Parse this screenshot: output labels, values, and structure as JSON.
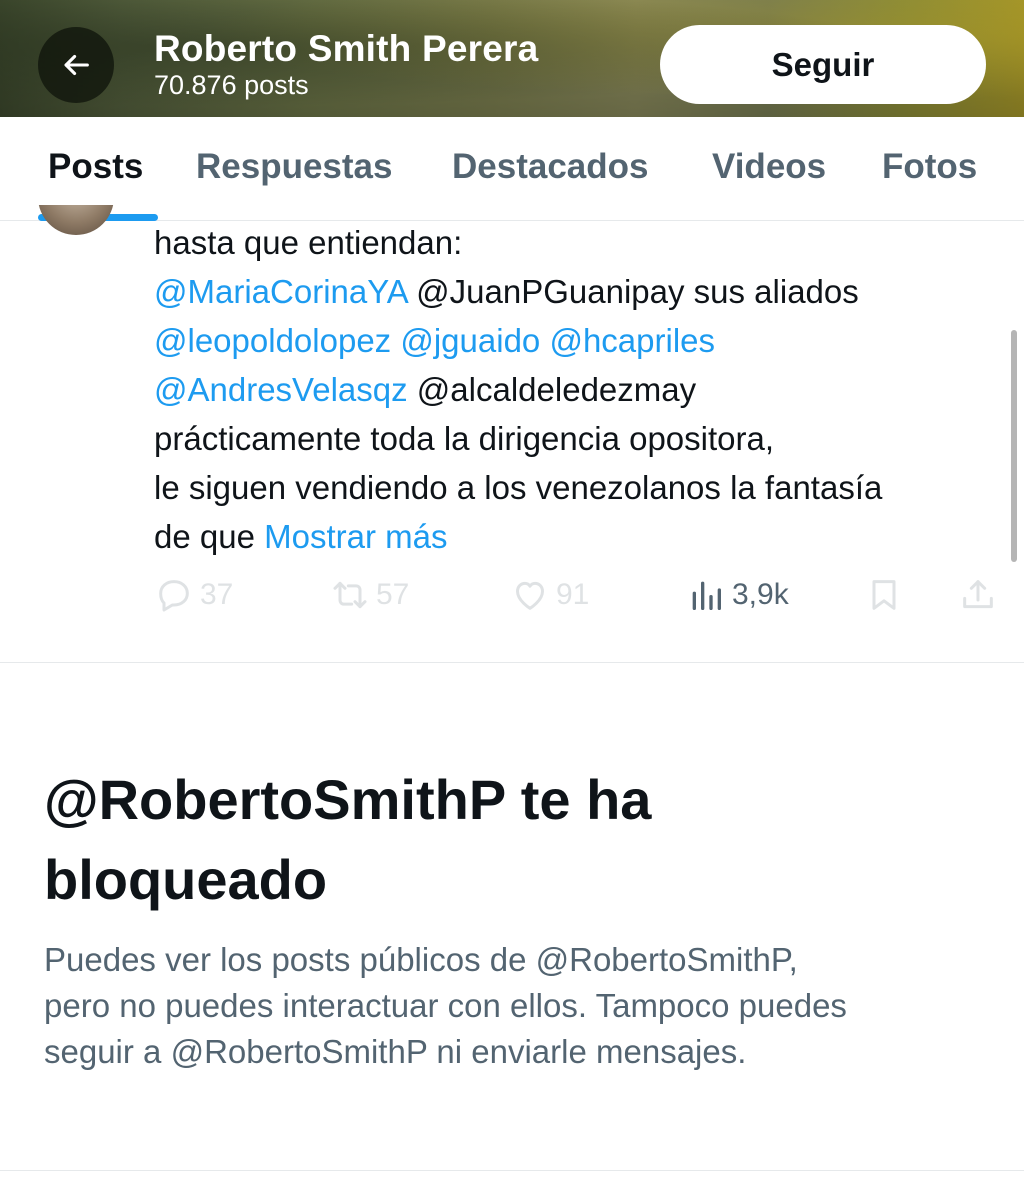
{
  "header": {
    "name": "Roberto Smith Perera",
    "post_count": "70.876 posts",
    "follow_label": "Seguir",
    "back_icon": "arrow-left-icon"
  },
  "tabs": [
    {
      "label": "Posts",
      "active": true
    },
    {
      "label": "Respuestas",
      "active": false
    },
    {
      "label": "Destacados",
      "active": false
    },
    {
      "label": "Videos",
      "active": false
    },
    {
      "label": "Fotos",
      "active": false
    }
  ],
  "tweet": {
    "lines": [
      [
        {
          "t": "hasta que entiendan:",
          "m": false
        }
      ],
      [
        {
          "t": "@MariaCorinaYA",
          "m": true
        },
        {
          "t": " @JuanPGuanipay sus aliados",
          "m": false
        }
      ],
      [
        {
          "t": "@leopoldolopez",
          "m": true
        },
        {
          "t": " ",
          "m": false
        },
        {
          "t": "@jguaido",
          "m": true
        },
        {
          "t": " ",
          "m": false
        },
        {
          "t": "@hcapriles",
          "m": true
        }
      ],
      [
        {
          "t": "@AndresVelasqz",
          "m": true
        },
        {
          "t": " @alcaldeledezmay",
          "m": false
        }
      ],
      [
        {
          "t": "prácticamente toda la dirigencia opositora,",
          "m": false
        }
      ],
      [
        {
          "t": "le siguen vendiendo a los venezolanos la fantasía",
          "m": false
        }
      ],
      [
        {
          "t": "de que ",
          "m": false
        }
      ]
    ],
    "show_more": "Mostrar más",
    "stats": {
      "replies": "37",
      "reposts": "57",
      "likes": "91",
      "views": "3,9k"
    }
  },
  "blocked": {
    "title_line1": "@RobertoSmithP te ha",
    "title_line2": "bloqueado",
    "desc_line1": "Puedes ver los posts públicos de @RobertoSmithP,",
    "desc_line2": "pero no puedes interactuar con ellos. Tampoco puedes",
    "desc_line3": "seguir a @RobertoSmithP ni enviarle mensajes."
  },
  "colors": {
    "accent": "#1d9bf0",
    "text_primary": "#0f1419",
    "text_secondary": "#536471",
    "divider": "#e6e9eb"
  }
}
